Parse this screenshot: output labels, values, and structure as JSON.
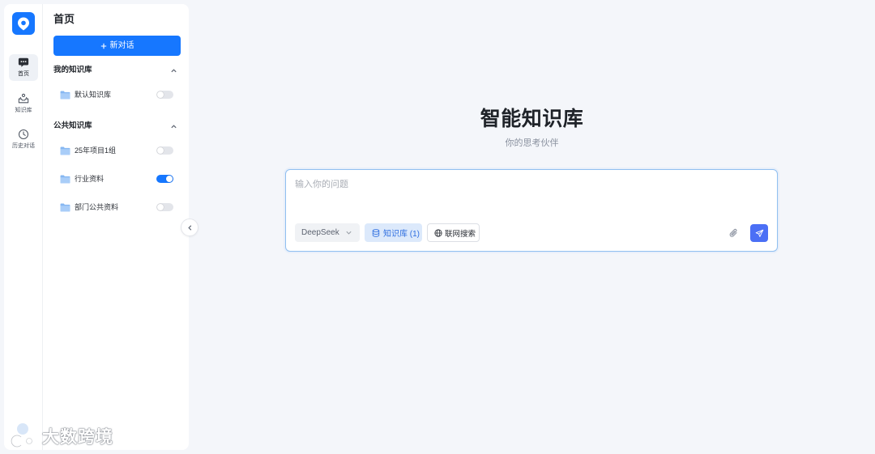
{
  "theme": {
    "accent": "#1677ff",
    "send_button": "#4b6ff5",
    "page_background": "#f4f6fa"
  },
  "app": {
    "logo_icon": "location-pin-icon"
  },
  "rail": {
    "items": [
      {
        "label": "首页",
        "icon": "chat-bubble-icon",
        "active": true
      },
      {
        "label": "知识库",
        "icon": "inbox-icon",
        "active": false
      },
      {
        "label": "历史对话",
        "icon": "clock-icon",
        "active": false
      }
    ]
  },
  "sidebar": {
    "title": "首页",
    "new_chat_icon": "plus-icon",
    "new_chat_label": "新对话",
    "sections": [
      {
        "title": "我的知识库",
        "expanded": true,
        "items": [
          {
            "label": "默认知识库",
            "icon": "folder-icon",
            "enabled": false
          }
        ]
      },
      {
        "title": "公共知识库",
        "expanded": true,
        "items": [
          {
            "label": "25年项目1组",
            "icon": "folder-icon",
            "enabled": false
          },
          {
            "label": "行业资料",
            "icon": "folder-icon",
            "enabled": true
          },
          {
            "label": "部门公共资料",
            "icon": "folder-icon",
            "enabled": false
          }
        ]
      }
    ],
    "collapse_icon": "chevron-left-icon"
  },
  "main": {
    "title": "智能知识库",
    "subtitle": "你的思考伙伴",
    "composer": {
      "placeholder": "输入你的问题",
      "model_label": "DeepSeek",
      "knowledge_icon": "database-icon",
      "knowledge_label": "知识库 (1)",
      "web_search_icon": "globe-icon",
      "web_search_label": "联网搜索",
      "attach_icon": "paperclip-icon",
      "send_icon": "send-icon"
    }
  },
  "watermark": {
    "text": "大数跨境"
  }
}
